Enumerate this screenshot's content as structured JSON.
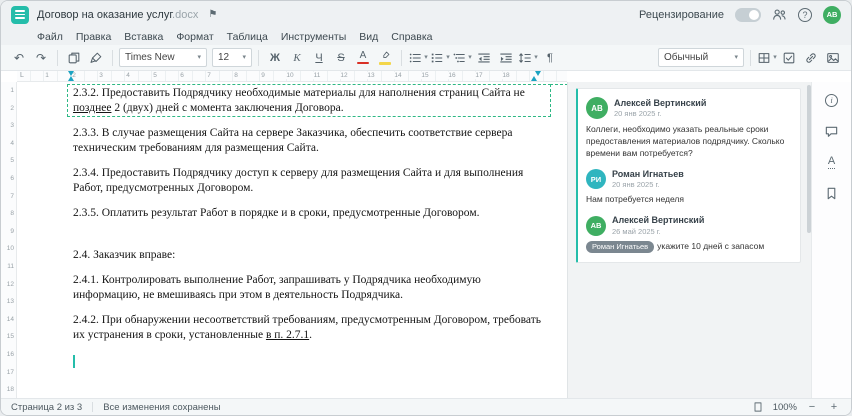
{
  "header": {
    "title": "Договор на оказание услуг",
    "title_ext": ".docx",
    "review_label": "Рецензирование",
    "avatar_initials": "АВ"
  },
  "menu": {
    "items": [
      "Файл",
      "Правка",
      "Вставка",
      "Формат",
      "Таблица",
      "Инструменты",
      "Вид",
      "Справка"
    ]
  },
  "toolbar": {
    "font_family": "Times New",
    "font_size": "12",
    "style_name": "Обычный",
    "bold": "Ж",
    "italic": "К",
    "underline": "Ч",
    "strikethrough": "S",
    "font_color_letter": "А"
  },
  "icons": {
    "undo": "↶",
    "redo": "↷",
    "caret_down": "▾",
    "flag": "⚑",
    "help": "?",
    "info": "i",
    "pilcrow": "¶",
    "zoom_out": "−",
    "zoom_in": "+",
    "spellcheck_letter": "А",
    "tab_stop": "L"
  },
  "colors": {
    "accent_teal": "#24bdaa",
    "avatar_green": "#3fae62",
    "avatar_cyan": "#2fb5bf",
    "comment_outline_green": "#2eb885",
    "ruler_marker_blue": "#1ba3c2",
    "font_color_red": "#d93025",
    "highlight_yellow": "#f3d64a"
  },
  "ruler": {
    "horizontal": [
      "1",
      "2",
      "3",
      "4",
      "5",
      "6",
      "7",
      "8",
      "9",
      "10",
      "11",
      "12",
      "13",
      "14",
      "15",
      "16",
      "17",
      "18"
    ],
    "vertical": [
      "1",
      "2",
      "3",
      "4",
      "5",
      "6",
      "7",
      "8",
      "9",
      "10",
      "11",
      "12",
      "13",
      "14",
      "15",
      "16",
      "17",
      "18"
    ]
  },
  "document": {
    "paragraphs": [
      {
        "runs": [
          {
            "text": "2.3.2. Предоставить Подрядчику необходимые материалы для наполнения страниц Сайта не "
          },
          {
            "text": "позднее",
            "underline": true
          },
          {
            "text": " 2 (двух) дней с момента заключения Договора."
          }
        ]
      },
      {
        "runs": [
          {
            "text": "2.3.3. В случае размещения Сайта на сервере Заказчика, обеспечить соответствие сервера техническим требованиям для размещения Сайта."
          }
        ]
      },
      {
        "runs": [
          {
            "text": "2.3.4. Предоставить Подрядчику доступ к серверу для размещения Сайта и для выполнения Работ, предусмотренных Договором."
          }
        ]
      },
      {
        "runs": [
          {
            "text": "2.3.5. Оплатить результат Работ в порядке и в сроки, предусмотренные Договором."
          }
        ]
      },
      {
        "runs": [
          {
            "text": "2.4. Заказчик вправе:"
          }
        ]
      },
      {
        "runs": [
          {
            "text": "2.4.1. Контролировать выполнение Работ, запрашивать у Подрядчика необходимую информацию, не вмешиваясь при этом в деятельность Подрядчика."
          }
        ]
      },
      {
        "runs": [
          {
            "text": "2.4.2. При обнаружении несоответствий требованиям, предусмотренным Договором, требовать их устранения в сроки, установленные "
          },
          {
            "text": "в п. 2.7.1",
            "underline": true
          },
          {
            "text": "."
          }
        ]
      }
    ]
  },
  "comments_panel": {
    "thread": {
      "comment": {
        "initials": "АВ",
        "author": "Алексей Вертинский",
        "date": "20 янв 2025 г.",
        "text": "Коллеги, необходимо указать реальные сроки предоставления материалов подрядчику. Сколько времени вам потребуется?"
      },
      "replies": [
        {
          "initials": "РИ",
          "author": "Роман Игнатьев",
          "date": "20 янв 2025 г.",
          "text": "Нам потребуется неделя"
        },
        {
          "initials": "АВ",
          "author": "Алексей Вертинский",
          "date": "26 май 2025 г.",
          "mention": "Роман Игнатьев",
          "text": "укажите 10 дней с запасом"
        }
      ]
    }
  },
  "status_bar": {
    "page_info": "Страница 2 из 3",
    "saved_status": "Все изменения сохранены",
    "zoom_value": "100%"
  }
}
